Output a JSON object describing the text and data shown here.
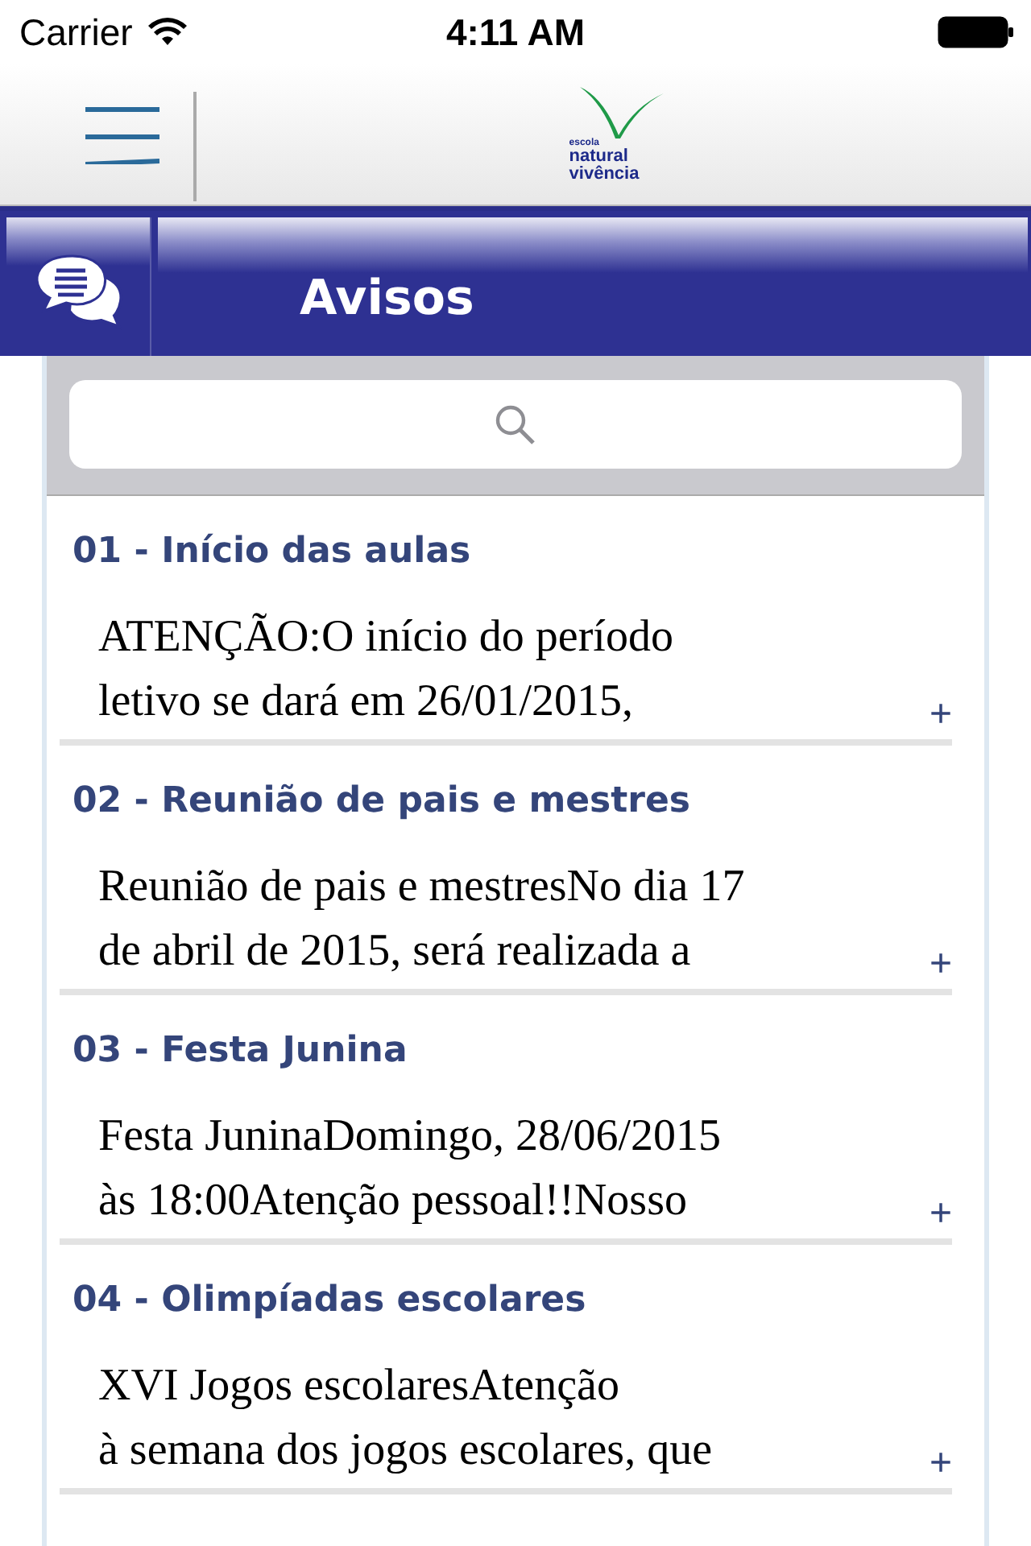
{
  "status_bar": {
    "carrier": "Carrier",
    "time": "4:11 AM"
  },
  "logo": {
    "lines": [
      "escola",
      "natural",
      "vivência"
    ]
  },
  "section": {
    "title": "Avisos"
  },
  "notices": [
    {
      "title": "01 - Início das aulas",
      "lines": [
        "ATENÇÃO:O início do período",
        "letivo se dará em 26/01/2015,"
      ],
      "expand": "+"
    },
    {
      "title": "02 - Reunião de pais e mestres",
      "lines": [
        "Reunião de pais e mestresNo dia 17",
        "de abril de 2015, será realizada a"
      ],
      "expand": "+"
    },
    {
      "title": "03 - Festa Junina",
      "lines": [
        "Festa JuninaDomingo, 28/06/2015",
        "às 18:00Atenção pessoal!!Nosso"
      ],
      "expand": "+"
    },
    {
      "title": "04 - Olimpíadas escolares",
      "lines": [
        "XVI Jogos escolaresAtenção",
        "à semana dos jogos escolares, que"
      ],
      "expand": "+"
    }
  ]
}
